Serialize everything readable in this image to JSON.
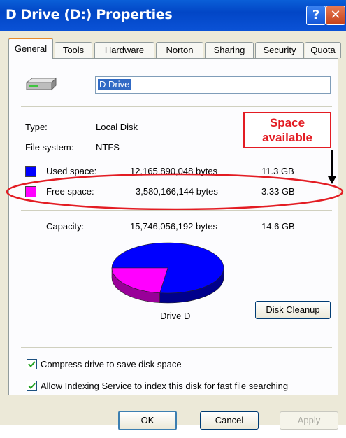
{
  "window": {
    "title": "D Drive (D:) Properties",
    "help_glyph": "?",
    "close_glyph": "✕"
  },
  "tabs": [
    {
      "label": "General",
      "active": true
    },
    {
      "label": "Tools"
    },
    {
      "label": "Hardware"
    },
    {
      "label": "Norton"
    },
    {
      "label": "Sharing"
    },
    {
      "label": "Security"
    },
    {
      "label": "Quota"
    }
  ],
  "general": {
    "drive_icon": "hard-drive-icon",
    "drive_name": "D Drive",
    "type_label": "Type:",
    "type_value": "Local Disk",
    "filesystem_label": "File system:",
    "filesystem_value": "NTFS",
    "used": {
      "label": "Used space:",
      "bytes": "12,165,890,048 bytes",
      "size": "11.3 GB",
      "color": "#0000ff"
    },
    "free": {
      "label": "Free space:",
      "bytes": "3,580,166,144 bytes",
      "size": "3.33 GB",
      "color": "#ff00ff"
    },
    "capacity": {
      "label": "Capacity:",
      "bytes": "15,746,056,192 bytes",
      "size": "14.6 GB"
    },
    "drive_caption": "Drive D",
    "cleanup_button": "Disk Cleanup",
    "compress_label": "Compress drive to save disk space",
    "compress_checked": true,
    "index_label": "Allow Indexing Service to index this disk for fast file searching",
    "index_checked": true
  },
  "annotation": {
    "callout_line1": "Space",
    "callout_line2": "available",
    "color": "#e31c23"
  },
  "buttons": {
    "ok": "OK",
    "cancel": "Cancel",
    "apply": "Apply"
  },
  "chart_data": {
    "type": "pie",
    "categories": [
      "Used space",
      "Free space"
    ],
    "values": [
      12165890048,
      3580166144
    ],
    "colors": [
      "#0000ff",
      "#ff00ff"
    ],
    "title": "Drive D"
  }
}
